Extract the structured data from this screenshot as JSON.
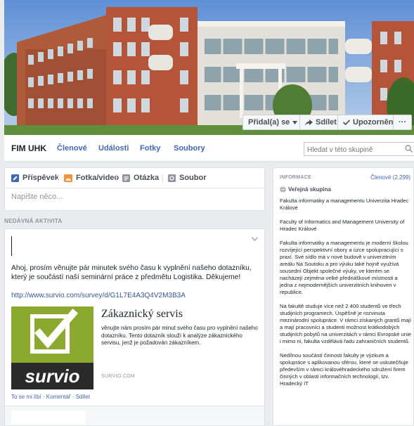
{
  "cover": {
    "buttons": {
      "joined": "Přidal(a) se",
      "share": "Sdílet",
      "notifications": "Upozornění",
      "more": "···"
    }
  },
  "nav": {
    "group_name": "FIM UHK",
    "items": [
      "Členové",
      "Události",
      "Fotky",
      "Soubory"
    ],
    "search_placeholder": "Hledat v této skupině"
  },
  "composer": {
    "tabs": [
      "Příspěvek",
      "Fotka/video",
      "Otázka",
      "Soubor"
    ],
    "placeholder": "Napište něco..."
  },
  "recent_activity_label": "NEDÁVNÁ AKTIVITA",
  "post": {
    "text": "Ahoj, prosím věnujte pár minutek svého času k vyplnění našeho dotazníku, který je součástí naší seminární práce z předmětu Logistika. Děkujeme!",
    "link": "http://www.survio.com/survey/d/G1L7E4A3Q4V2M3B3A",
    "preview": {
      "logo_word": "survio",
      "title": "Zákaznický servis",
      "description": "věnujte nám prosím pár minut svého času pro vyplnění našeho dotazníku. Tento dotazník slouží k analýze zákaznického servisu, jenž je požadován zákazníkem.",
      "domain": "SURVIO.COM"
    },
    "actions": "To se mi líbí · Komentář · Sdílet"
  },
  "info": {
    "heading": "INFORMACE",
    "members": "Členové (2.299)",
    "group_type": "Veřejná skupina",
    "paragraphs": [
      "Fakulta informatiky a managementu Univerzita Hradec Králové",
      "Faculty of Informatics and Management University of Hradec Králové",
      "Fakulta informatiky a managementu je moderní školou rozvíjející perspektivní obory a úzce spolupracující s praxí. Své sídlo má v nové budově v univerzitním areálu Na Soutoku a pro výuku také hojně využívá sousední Objekt společné výuky, ve kterém se nacházejí zejména velké přednáškové místnosti a jedna z nejmodernějších univerzitních knihoven v republice.",
      "Na fakultě studuje více než 2 400 studentů ve třech studijních programech. Úspěšně je rozvinuta mezinárodní spolupráce. V rámci získaných grantů mají a mají pracovníci a studenti možnost krátkodobých studijních pobytů na univerzitách v rámci Evropské unie i mimo ni, fakulta vzdělává řadu zahraničních studentů.",
      "Nedílnou součástí činnosti fakulty je výzkum a spolupráce s aplikovanou sférou, které se uskutečňuje především v rámci královéhradeckého sdružení firem činných v oblasti informačních technologií, tzv. Hradecký IT"
    ]
  }
}
